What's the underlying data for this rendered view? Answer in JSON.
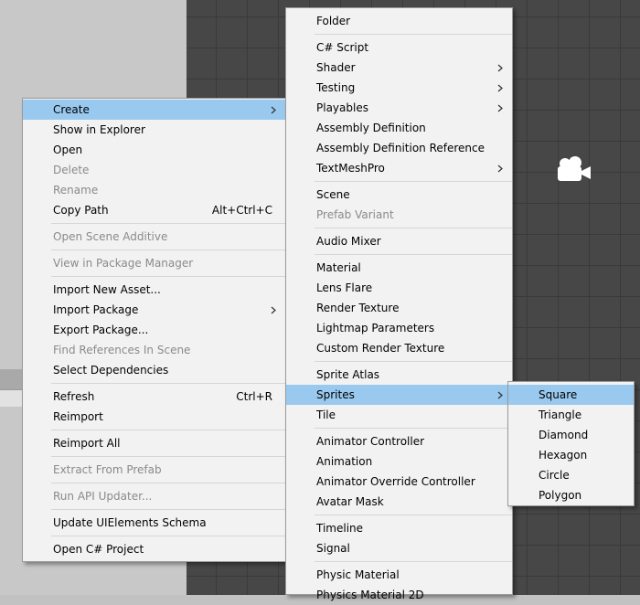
{
  "context_menu": {
    "items": [
      {
        "label": "Create",
        "submenu": true,
        "highlighted": true
      },
      {
        "label": "Show in Explorer"
      },
      {
        "label": "Open"
      },
      {
        "label": "Delete",
        "disabled": true
      },
      {
        "label": "Rename",
        "disabled": true
      },
      {
        "label": "Copy Path",
        "shortcut": "Alt+Ctrl+C"
      },
      {
        "separator": true
      },
      {
        "label": "Open Scene Additive",
        "disabled": true
      },
      {
        "separator": true
      },
      {
        "label": "View in Package Manager",
        "disabled": true
      },
      {
        "separator": true
      },
      {
        "label": "Import New Asset..."
      },
      {
        "label": "Import Package",
        "submenu": true
      },
      {
        "label": "Export Package..."
      },
      {
        "label": "Find References In Scene",
        "disabled": true
      },
      {
        "label": "Select Dependencies"
      },
      {
        "separator": true
      },
      {
        "label": "Refresh",
        "shortcut": "Ctrl+R"
      },
      {
        "label": "Reimport"
      },
      {
        "separator": true
      },
      {
        "label": "Reimport All"
      },
      {
        "separator": true
      },
      {
        "label": "Extract From Prefab",
        "disabled": true
      },
      {
        "separator": true
      },
      {
        "label": "Run API Updater...",
        "disabled": true
      },
      {
        "separator": true
      },
      {
        "label": "Update UIElements Schema"
      },
      {
        "separator": true
      },
      {
        "label": "Open C# Project"
      }
    ]
  },
  "create_menu": {
    "items": [
      {
        "label": "Folder"
      },
      {
        "separator": true
      },
      {
        "label": "C# Script"
      },
      {
        "label": "Shader",
        "submenu": true
      },
      {
        "label": "Testing",
        "submenu": true
      },
      {
        "label": "Playables",
        "submenu": true
      },
      {
        "label": "Assembly Definition"
      },
      {
        "label": "Assembly Definition Reference"
      },
      {
        "label": "TextMeshPro",
        "submenu": true
      },
      {
        "separator": true
      },
      {
        "label": "Scene"
      },
      {
        "label": "Prefab Variant",
        "disabled": true
      },
      {
        "separator": true
      },
      {
        "label": "Audio Mixer"
      },
      {
        "separator": true
      },
      {
        "label": "Material"
      },
      {
        "label": "Lens Flare"
      },
      {
        "label": "Render Texture"
      },
      {
        "label": "Lightmap Parameters"
      },
      {
        "label": "Custom Render Texture"
      },
      {
        "separator": true
      },
      {
        "label": "Sprite Atlas"
      },
      {
        "label": "Sprites",
        "submenu": true,
        "highlighted": true
      },
      {
        "label": "Tile"
      },
      {
        "separator": true
      },
      {
        "label": "Animator Controller"
      },
      {
        "label": "Animation"
      },
      {
        "label": "Animator Override Controller"
      },
      {
        "label": "Avatar Mask"
      },
      {
        "separator": true
      },
      {
        "label": "Timeline"
      },
      {
        "label": "Signal"
      },
      {
        "separator": true
      },
      {
        "label": "Physic Material"
      },
      {
        "label": "Physics Material 2D"
      }
    ]
  },
  "sprites_menu": {
    "items": [
      {
        "label": "Square",
        "highlighted": true
      },
      {
        "label": "Triangle"
      },
      {
        "label": "Diamond"
      },
      {
        "label": "Hexagon"
      },
      {
        "label": "Circle"
      },
      {
        "label": "Polygon"
      }
    ]
  },
  "icons": {
    "scene_gizmo": "camera-icon",
    "submenu_arrow": "chevron-right-icon"
  },
  "colors": {
    "highlight": "#99c9ef",
    "menu_bg": "#f2f2f2",
    "disabled_text": "#8a8a8a",
    "scene_bg": "#474747"
  }
}
